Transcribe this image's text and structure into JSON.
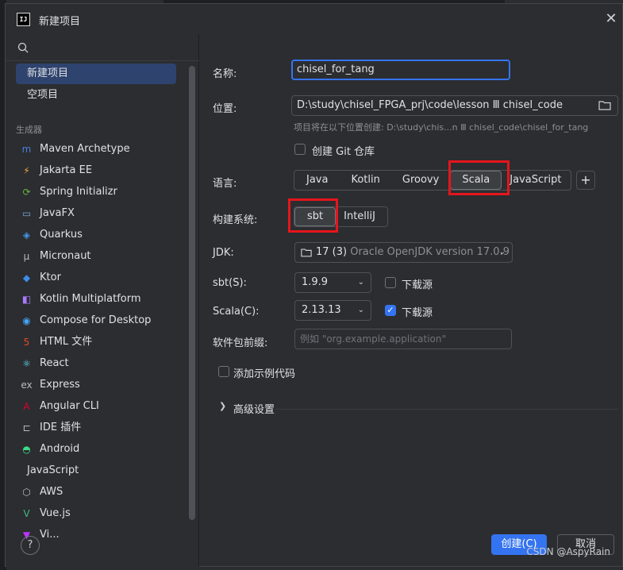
{
  "window": {
    "title": "新建项目",
    "logo": "IJ"
  },
  "sidebar": {
    "search_placeholder": "",
    "top_items": [
      {
        "label": "新建项目",
        "selected": true
      },
      {
        "label": "空项目",
        "selected": false
      }
    ],
    "group_label": "生成器",
    "generators": [
      {
        "label": "Maven Archetype",
        "icon": "m",
        "color": "#4a7fe0"
      },
      {
        "label": "Jakarta EE",
        "icon": "⚡",
        "color": "#f2a53a"
      },
      {
        "label": "Spring Initializr",
        "icon": "⟳",
        "color": "#6db33f"
      },
      {
        "label": "JavaFX",
        "icon": "▭",
        "color": "#7aa3d8"
      },
      {
        "label": "Quarkus",
        "icon": "◈",
        "color": "#4695eb"
      },
      {
        "label": "Micronaut",
        "icon": "μ",
        "color": "#bbbbbb"
      },
      {
        "label": "Ktor",
        "icon": "◆",
        "color": "#3b8eea"
      },
      {
        "label": "Kotlin Multiplatform",
        "icon": "◧",
        "color": "#a97bff"
      },
      {
        "label": "Compose for Desktop",
        "icon": "◉",
        "color": "#42a5f5"
      },
      {
        "label": "HTML 文件",
        "icon": "5",
        "color": "#e44d26"
      },
      {
        "label": "React",
        "icon": "⚛",
        "color": "#61dafb"
      },
      {
        "label": "Express",
        "icon": "ex",
        "color": "#bbbbbb"
      },
      {
        "label": "Angular CLI",
        "icon": "A",
        "color": "#dd0031"
      },
      {
        "label": "IDE 插件",
        "icon": "⊏",
        "color": "#bbbbbb"
      },
      {
        "label": "Android",
        "icon": "◓",
        "color": "#3ddc84"
      },
      {
        "label": "JavaScript",
        "icon": "",
        "color": "#dfe1e5"
      },
      {
        "label": "AWS",
        "icon": "⬡",
        "color": "#bbbbbb"
      },
      {
        "label": "Vue.js",
        "icon": "V",
        "color": "#41b883"
      },
      {
        "label": "Vi...",
        "icon": "▼",
        "color": "#bd34fe"
      }
    ],
    "help_label": "?"
  },
  "form": {
    "name_label": "名称:",
    "name_value": "chisel_for_tang",
    "location_label": "位置:",
    "location_value": "D:\\study\\chisel_FPGA_prj\\code\\lesson Ⅲ chisel_code",
    "location_hint": "项目将在以下位置创建: D:\\study\\chis...n Ⅲ chisel_code\\chisel_for_tang",
    "git_label": "创建 Git 仓库",
    "git_checked": false,
    "language_label": "语言:",
    "languages": [
      "Java",
      "Kotlin",
      "Groovy",
      "Scala",
      "JavaScript"
    ],
    "language_selected": "Scala",
    "add_language": "+",
    "build_label": "构建系统:",
    "build_systems": [
      "sbt",
      "IntelliJ"
    ],
    "build_selected": "sbt",
    "jdk_label": "JDK:",
    "jdk_version": "17 (3)",
    "jdk_detail": "Oracle OpenJDK version 17.0.9",
    "sbt_label": "sbt(S):",
    "sbt_version": "1.9.9",
    "sbt_download_label": "下载源",
    "sbt_download_checked": false,
    "scala_label": "Scala(C):",
    "scala_version": "2.13.13",
    "scala_download_label": "下载源",
    "scala_download_checked": true,
    "package_label": "软件包前缀:",
    "package_placeholder": "例如 \"org.example.application\"",
    "sample_code_label": "添加示例代码",
    "sample_code_checked": false,
    "advanced_label": "高级设置"
  },
  "footer": {
    "create_label": "创建(C)",
    "cancel_label": "取消",
    "watermark": "CSDN @AspyRain"
  },
  "colors": {
    "accent": "#3574f0",
    "highlight": "#e5151c",
    "background": "#2b2d30"
  }
}
